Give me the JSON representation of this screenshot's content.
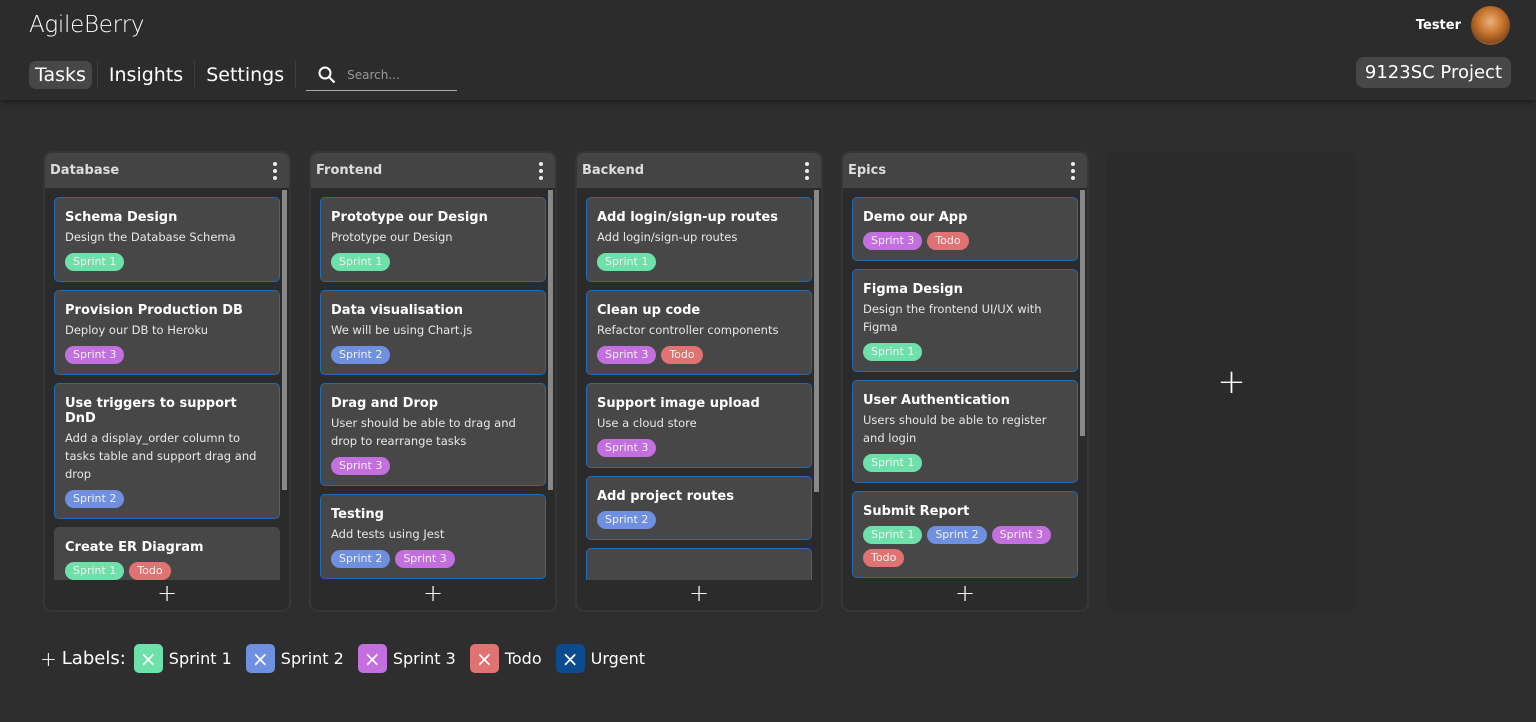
{
  "app": {
    "title": "AgileBerry"
  },
  "nav": {
    "items": [
      {
        "label": "Tasks",
        "active": true
      },
      {
        "label": "Insights"
      },
      {
        "label": "Settings"
      }
    ],
    "search_placeholder": "Search..."
  },
  "user": {
    "name": "Tester"
  },
  "project": {
    "name": "9123SC Project"
  },
  "tag_colors": {
    "Sprint 1": "#6ee0aa",
    "Sprint 2": "#6f8fe0",
    "Sprint 3": "#c46fe0",
    "Todo": "#e07272",
    "Urgent": "#0e4a8e"
  },
  "columns": [
    {
      "title": "Database",
      "cards": [
        {
          "title": "Schema Design",
          "desc": "Design the Database Schema",
          "tags": [
            "Sprint 1"
          ]
        },
        {
          "title": "Provision Production DB",
          "desc": "Deploy our DB to Heroku",
          "tags": [
            "Sprint 3"
          ]
        },
        {
          "title": "Use triggers to support DnD",
          "desc": "Add a display_order column to tasks table and support drag and drop",
          "tags": [
            "Sprint 2"
          ]
        },
        {
          "title": "Create ER Diagram",
          "desc": "",
          "tags": [
            "Sprint 1",
            "Todo"
          ],
          "noborder": true
        }
      ]
    },
    {
      "title": "Frontend",
      "cards": [
        {
          "title": "Prototype our Design",
          "desc": "Prototype our Design",
          "tags": [
            "Sprint 1"
          ]
        },
        {
          "title": "Data visualisation",
          "desc": "We will be using Chart.js",
          "tags": [
            "Sprint 2"
          ]
        },
        {
          "title": "Drag and Drop",
          "desc": "User should be able to drag and drop to rearrange tasks",
          "tags": [
            "Sprint 3"
          ]
        },
        {
          "title": "Testing",
          "desc": "Add tests using Jest",
          "tags": [
            "Sprint 2",
            "Sprint 3"
          ]
        }
      ]
    },
    {
      "title": "Backend",
      "cards": [
        {
          "title": "Add login/sign-up routes",
          "desc": "Add login/sign-up routes",
          "tags": [
            "Sprint 1"
          ]
        },
        {
          "title": "Clean up code",
          "desc": "Refactor controller components",
          "tags": [
            "Sprint 3",
            "Todo"
          ]
        },
        {
          "title": "Support image upload",
          "desc": "Use a cloud store",
          "tags": [
            "Sprint 3"
          ]
        },
        {
          "title": "Add project routes",
          "desc": "",
          "tags": [
            "Sprint 2"
          ]
        },
        {
          "title": "",
          "desc": "",
          "tags": []
        }
      ]
    },
    {
      "title": "Epics",
      "cards": [
        {
          "title": "Demo our App",
          "desc": "",
          "tags": [
            "Sprint 3",
            "Todo"
          ]
        },
        {
          "title": "Figma Design",
          "desc": "Design the frontend UI/UX with Figma",
          "tags": [
            "Sprint 1"
          ]
        },
        {
          "title": "User Authentication",
          "desc": "Users should be able to register and login",
          "tags": [
            "Sprint 1"
          ]
        },
        {
          "title": "Submit Report",
          "desc": "",
          "tags": [
            "Sprint 1",
            "Sprint 2",
            "Sprint 3",
            "Todo"
          ]
        }
      ]
    }
  ],
  "labels": {
    "title": "Labels:",
    "items": [
      "Sprint 1",
      "Sprint 2",
      "Sprint 3",
      "Todo",
      "Urgent"
    ]
  },
  "icons": {
    "add": "+",
    "remove": "×"
  }
}
